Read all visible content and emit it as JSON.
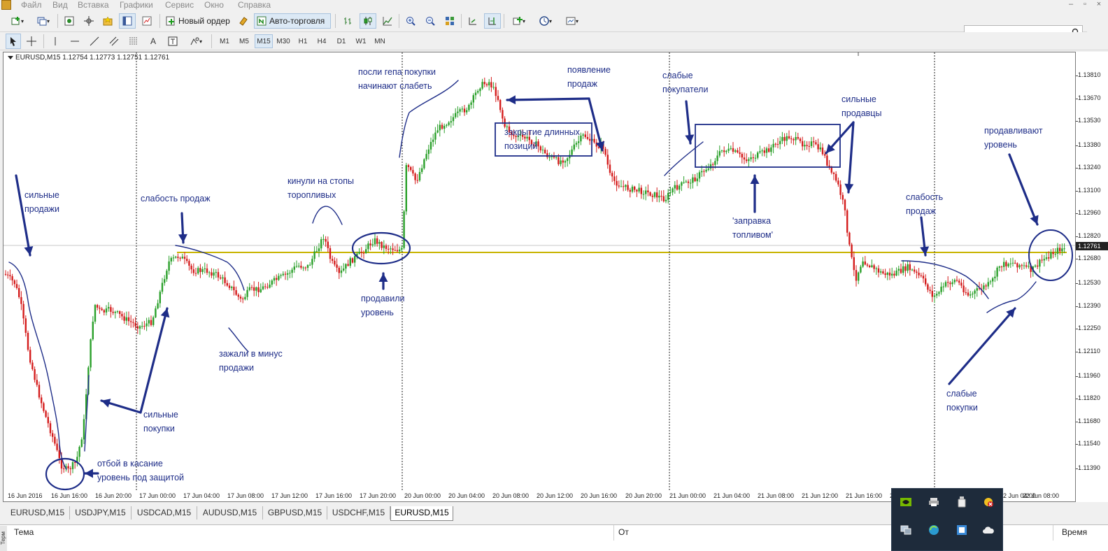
{
  "menu": {
    "items": [
      "Файл",
      "Вид",
      "Вставка",
      "Графики",
      "Сервис",
      "Окно",
      "Справка"
    ]
  },
  "toolbar": {
    "new_order_label": "Новый ордер",
    "auto_trading_label": "Авто-торговля",
    "timeframes": [
      "M1",
      "M5",
      "M15",
      "M30",
      "H1",
      "H4",
      "D1",
      "W1",
      "MN"
    ],
    "active_timeframe": "M15"
  },
  "chart": {
    "symbol_line": "EURUSD,M15  1.12754 1.12773 1.12751 1.12761",
    "current_price": "1.12761",
    "price_labels": [
      "1.13810",
      "1.13670",
      "1.13530",
      "1.13380",
      "1.13240",
      "1.13100",
      "1.12960",
      "1.12820",
      "1.12680",
      "1.12530",
      "1.12390",
      "1.12250",
      "1.12110",
      "1.11960",
      "1.11820",
      "1.11680",
      "1.11540",
      "1.11390"
    ],
    "time_labels": [
      "16 Jun 2016",
      "16 Jun 16:00",
      "16 Jun 20:00",
      "17 Jun 00:00",
      "17 Jun 04:00",
      "17 Jun 08:00",
      "17 Jun 12:00",
      "17 Jun 16:00",
      "17 Jun 20:00",
      "20 Jun 00:00",
      "20 Jun 04:00",
      "20 Jun 08:00",
      "20 Jun 12:00",
      "20 Jun 16:00",
      "20 Jun 20:00",
      "21 Jun 00:00",
      "21 Jun 04:00",
      "21 Jun 08:00",
      "21 Jun 12:00",
      "21 Jun 16:00",
      "21 Jun 20:00",
      "22 Jun 04:00",
      "22 Jun 08:00"
    ],
    "colors": {
      "bull": "#2aa02a",
      "bear": "#d41c1c",
      "level": "#c8b400",
      "annotation": "#1e2d88",
      "grid_h": "#c8c8c8"
    },
    "annotations": {
      "strong_sales": "сильные\nпродажи",
      "weak_sales_1": "слабость продаж",
      "strong_buys": "сильные\nпокупки",
      "bounce": "отбой в касание\nуровень под защитой",
      "stops": "кинули на стопы\nторопливых",
      "pinched": "зажали в минус\nпродажи",
      "pushed": "продавили\nуровень",
      "after_gap": "посли гепа покупки\nначинают слабеть",
      "close_longs": "закрытие длинных\nпозиций",
      "sales_appear": "появление\nпродаж",
      "weak_buyers": "слабые\nпокупатели",
      "refuel": "'заправка\nтопливом'",
      "strong_sellers": "сильные\nпродавцы",
      "weak_sales_2": "слабость\nпродаж",
      "weak_buys": "слабые\nпокупки",
      "pushing": "продавливают\nуровень"
    }
  },
  "symbol_tabs": [
    "EURUSD,M15",
    "USDJPY,M15",
    "USDCAD,M15",
    "AUDUSD,M15",
    "GBPUSD,M15",
    "USDCHF,M15",
    "EURUSD,M15"
  ],
  "active_tab_index": 6,
  "terminal": {
    "col_subject": "Тема",
    "col_from": "От",
    "col_time": "Время"
  }
}
